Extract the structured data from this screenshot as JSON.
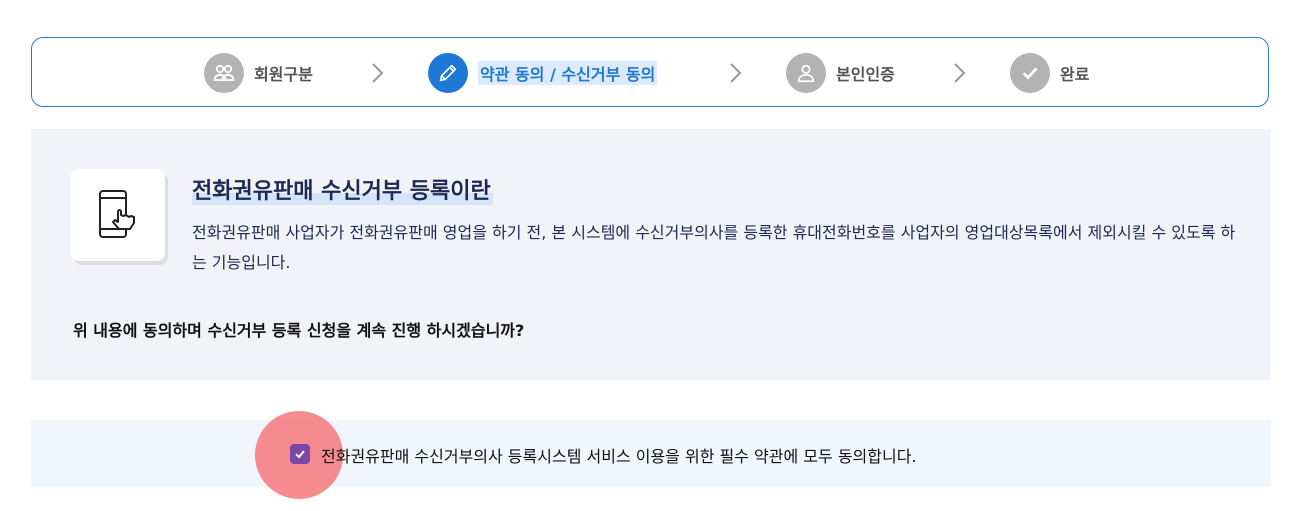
{
  "steps": [
    {
      "label": "회원구분",
      "icon": "users-icon",
      "active": false
    },
    {
      "label": "약관 동의 / 수신거부 동의",
      "icon": "pencil-icon",
      "active": true
    },
    {
      "label": "본인인증",
      "icon": "user-icon",
      "active": false
    },
    {
      "label": "완료",
      "icon": "check-icon",
      "active": false
    }
  ],
  "info": {
    "icon": "phone-touch-icon",
    "title": "전화권유판매 수신거부 등록이란",
    "description": "전화권유판매 사업자가 전화권유판매 영업을 하기 전, 본 시스템에 수신거부의사를 등록한 휴대전화번호를 사업자의 영업대상목록에서 제외시킬 수 있도록 하는 기능입니다.",
    "question": "위 내용에 동의하며 수신거부 등록 신청을 계속 진행 하시겠습니까?"
  },
  "agree": {
    "checked": true,
    "label": "전화권유판매 수신거부의사 등록시스템 서비스 이용을 위한 필수 약관에 모두 동의합니다."
  },
  "colors": {
    "accent": "#1d78d6",
    "inactive": "#b3b3b3",
    "checkbox": "#7b47a8",
    "title": "#1e2a55"
  }
}
